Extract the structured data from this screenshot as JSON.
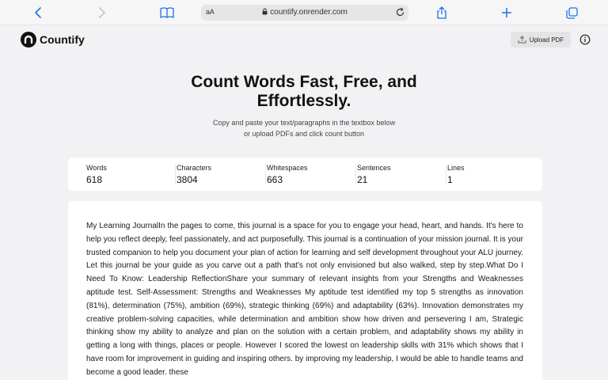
{
  "browser": {
    "text_size_label": "aA",
    "url": "countify.onrender.com"
  },
  "app": {
    "name": "Countify",
    "upload_label": "Upload PDF"
  },
  "hero": {
    "title": "Count Words Fast, Free, and Effortlessly.",
    "subtitle": "Copy and paste your text/paragraphs in the textbox below or upload PDFs and click count button"
  },
  "stats": [
    {
      "label": "Words",
      "value": "618"
    },
    {
      "label": "Characters",
      "value": "3804"
    },
    {
      "label": "Whitespaces",
      "value": "663"
    },
    {
      "label": "Sentences",
      "value": "21"
    },
    {
      "label": "Lines",
      "value": "1"
    }
  ],
  "textbox": {
    "content": "My Learning JournalIn the pages to come, this journal is a space for you to engage your head, heart, and hands. It's here to help you reflect deeply, feel passionately, and act purposefully. This journal is a continuation of your mission journal. It is your trusted companion to help you document your plan of action for learning and self development throughout your ALU journey. Let this journal be your guide as you carve out a path that's not only envisioned but also walked, step by step.What Do I Need To Know: Leadership ReflectionShare your summary of relevant insights from your Strengths and Weaknesses aptitude test.  Self-Assessment: Strengths and Weaknesses  My aptitude test identified my top 5 strengths as innovation (81%), determination (75%), ambition (69%), strategic thinking (69%) and adaptability (63%). Innovation demonstrates my creative problem-solving capacities, while determination and ambition show how driven and persevering I am, Strategic thinking show my ability to analyze and plan on the solution with a certain problem, and adaptability shows my ability in getting a long with things, places or people. However I scored the lowest on leadership skills with 31% which shows that I have room for improvement in guiding and inspiring others. by improving my leadership, I would be able to handle teams and become a good leader. these"
  },
  "colors": {
    "page_bg": "#f2f2f4",
    "card_bg": "#ffffff",
    "browser_accent": "#1a73e8"
  }
}
